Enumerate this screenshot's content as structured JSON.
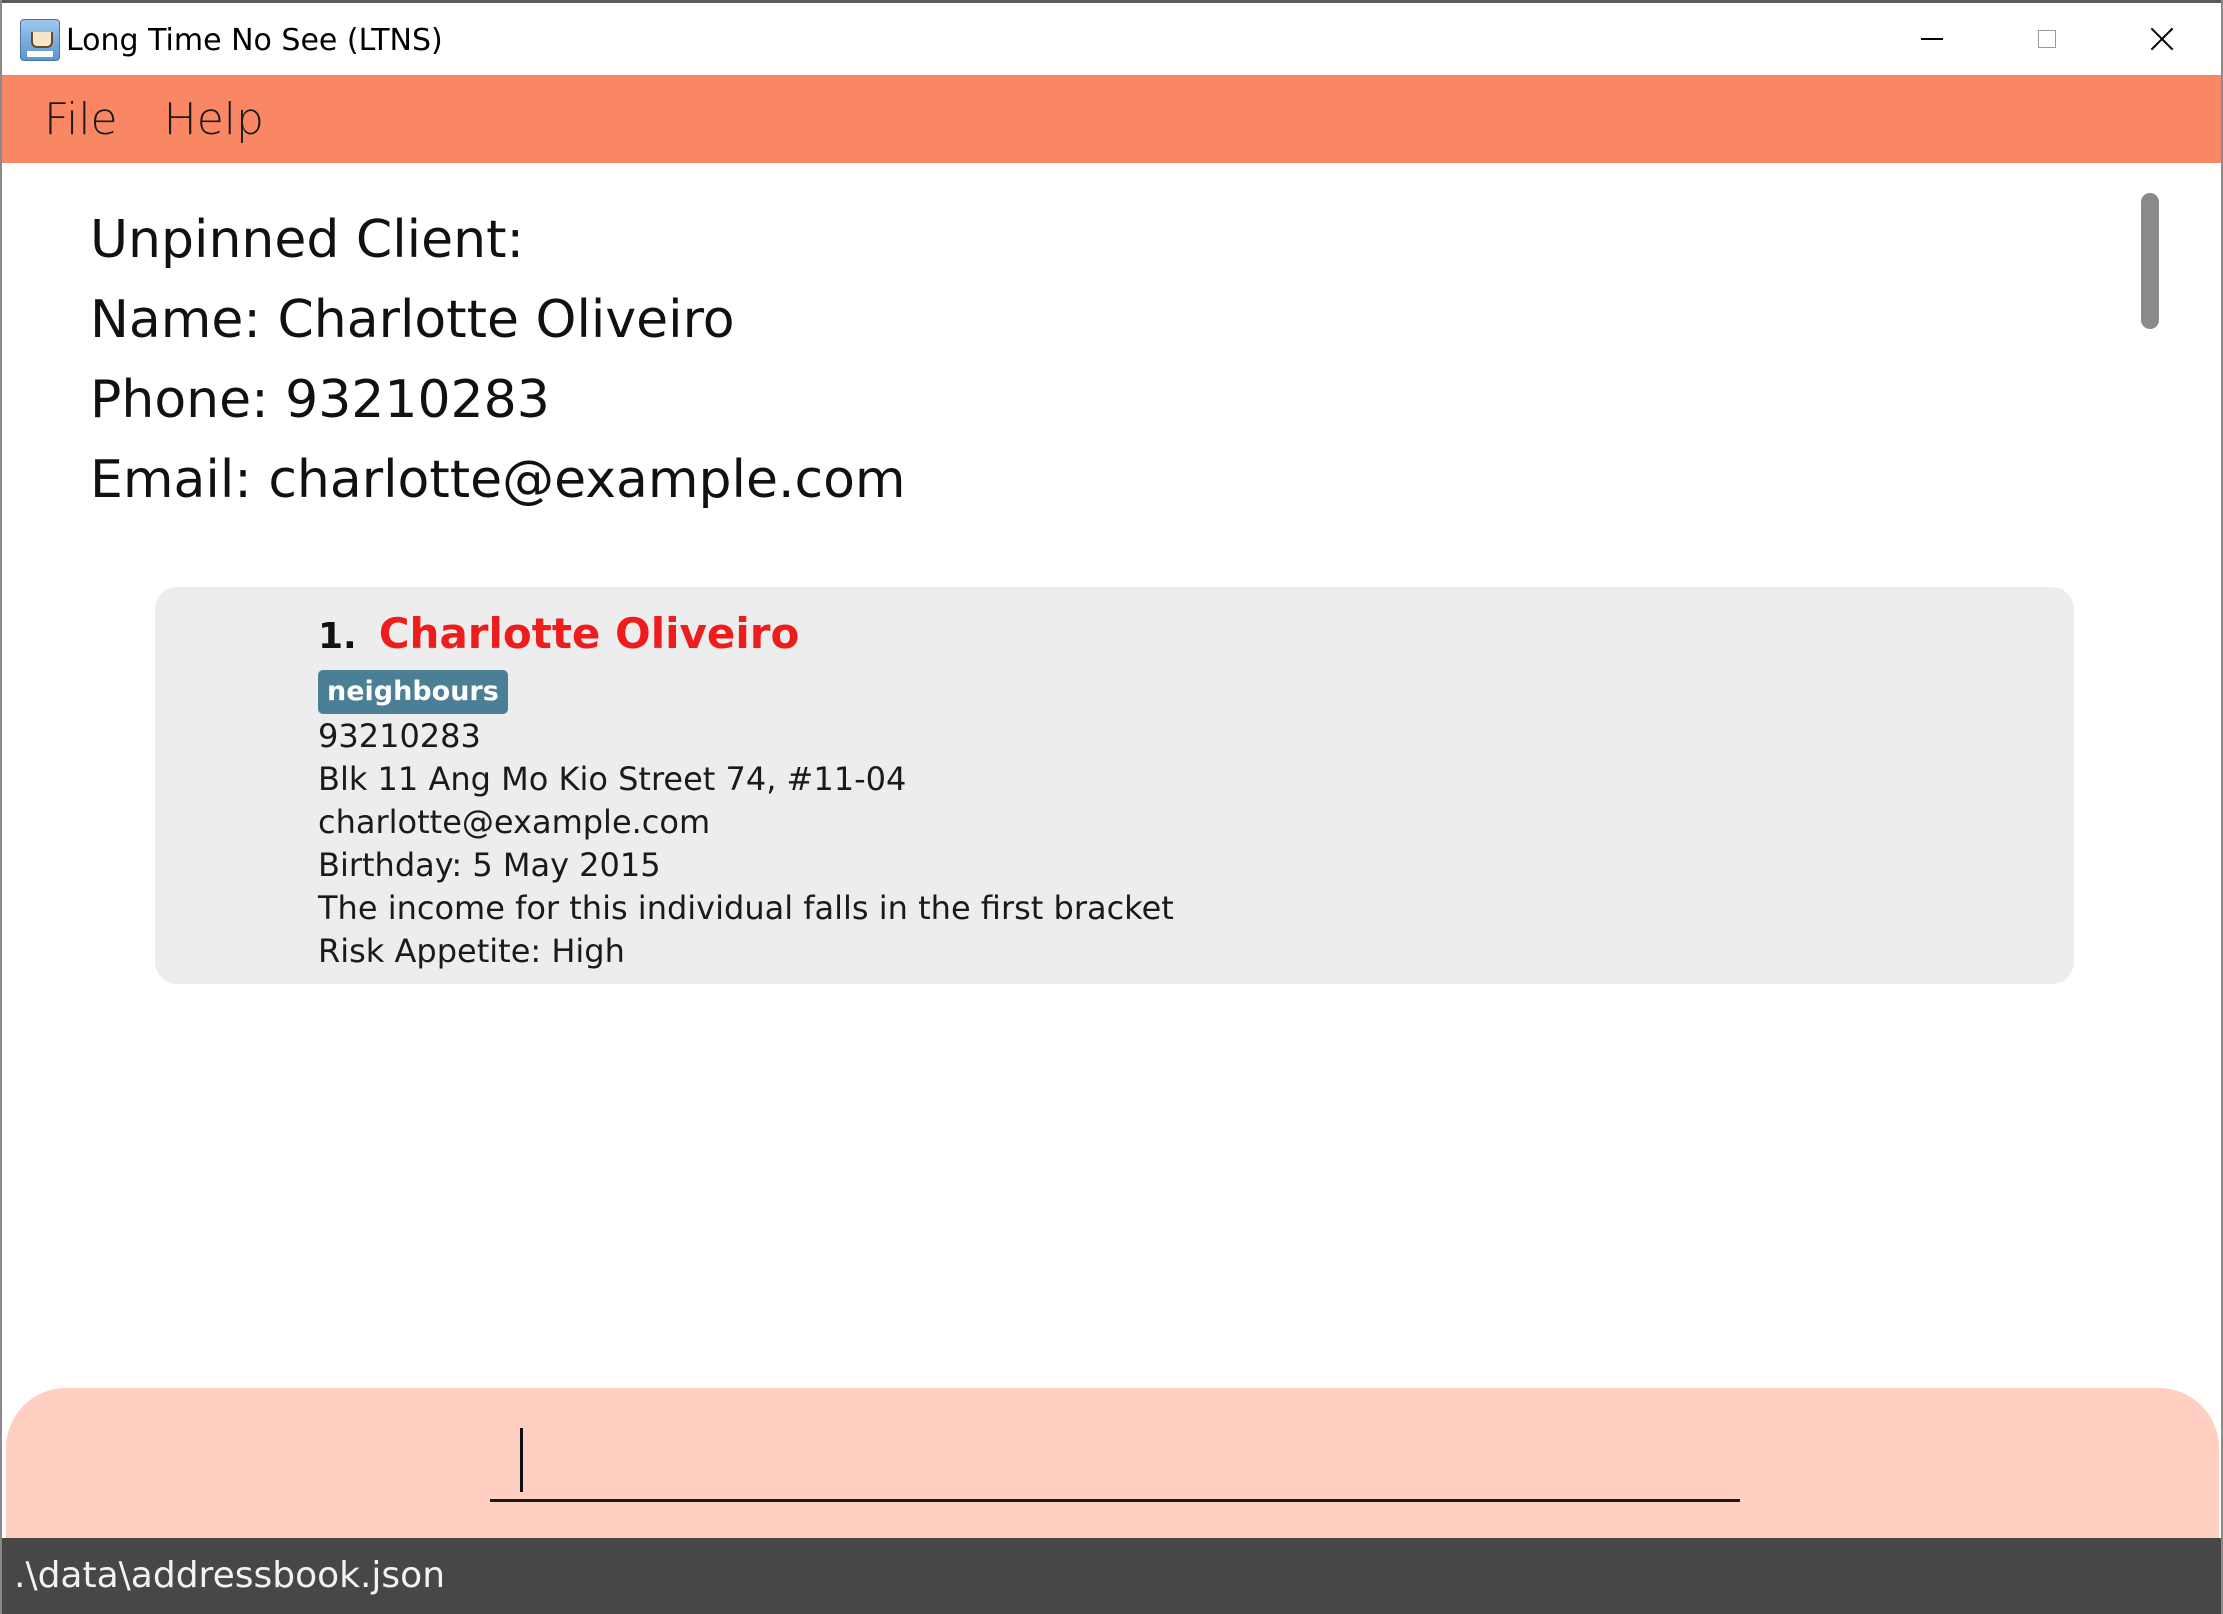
{
  "window": {
    "title": "Long Time No See (LTNS)"
  },
  "menubar": {
    "items": [
      {
        "label": "File"
      },
      {
        "label": "Help"
      }
    ]
  },
  "result": {
    "heading": "Unpinned Client:",
    "name_line": "Name: Charlotte Oliveiro",
    "phone_line": "Phone: 93210283",
    "email_line": "Email: charlotte@example.com"
  },
  "client_card": {
    "index": "1.",
    "name": "Charlotte Oliveiro",
    "tag": "neighbours",
    "phone": "93210283",
    "address": "Blk 11 Ang Mo Kio Street 74, #11-04",
    "email": "charlotte@example.com",
    "birthday": "Birthday: 5 May 2015",
    "income": "The income for this individual falls in the first bracket",
    "risk": "Risk Appetite: High"
  },
  "command_box": {
    "value": ""
  },
  "statusbar": {
    "path": ".\\data\\addressbook.json"
  },
  "colors": {
    "menubar": "#f98763",
    "command_area": "#ffcfc2",
    "statusbar": "#474747",
    "client_name": "#ee1d1d",
    "tag": "#4b7f95",
    "card": "#ededed"
  }
}
